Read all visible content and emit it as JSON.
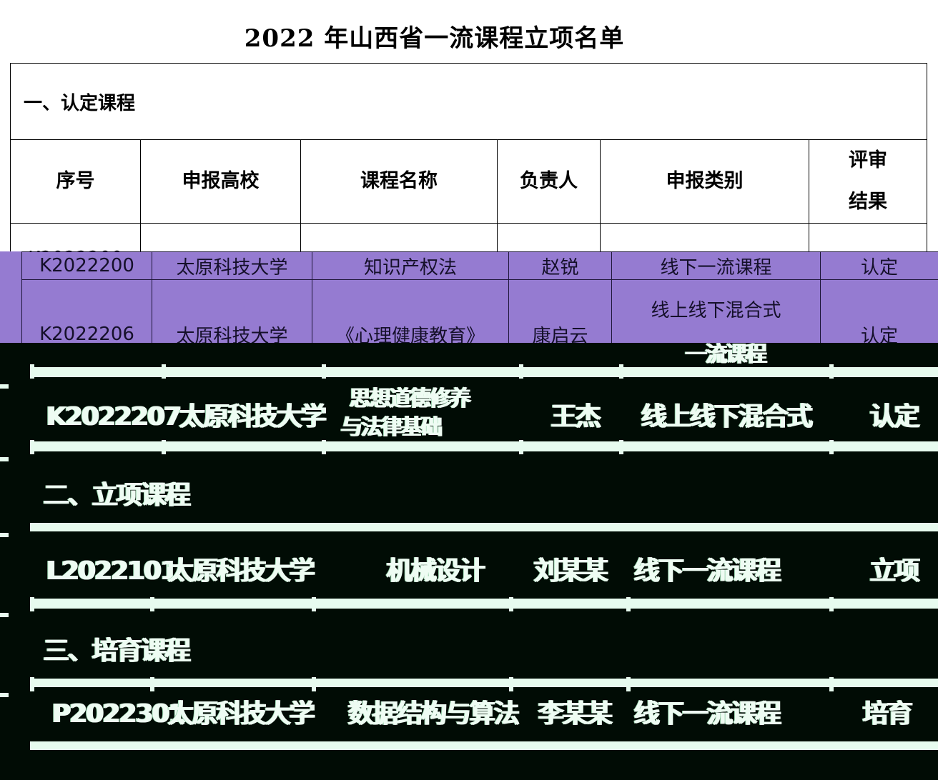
{
  "doc": {
    "title_year": "2022",
    "title_text": " 年山西省一流课程立项名单"
  },
  "section1": {
    "label": "一、认定课程"
  },
  "headers": {
    "index": "序号",
    "school": "申报高校",
    "course": "课程名称",
    "owner": "负责人",
    "category": "申报类别",
    "result_line1": "评审",
    "result_line2": "结果"
  },
  "rows": [
    {
      "index": "K2022200",
      "school": "太原科技大学",
      "course": "知识产权法",
      "owner": "赵锐",
      "category": "线下一流课程",
      "result": "认定"
    },
    {
      "index": "K2022206",
      "school": "太原科技大学",
      "course": "《心理健康教育》",
      "owner": "康启云",
      "category_line1": "线上线下混合式",
      "category_line2": "一流课程",
      "result": "认定"
    }
  ],
  "garbled": {
    "r3_cat": "一流课程",
    "r4_index": "K2022207",
    "r4_school": "太原科技大学",
    "r4_course_line1": "思想道德修养",
    "r4_course_line2": "与法律基础",
    "r4_owner": "王杰",
    "r4_category": "线上线下混合式",
    "r4_result": "认定",
    "section2": "二、立项课程",
    "r5_index": "L2022101",
    "r5_school": "太原科技大学",
    "r5_course": "机械设计",
    "r5_owner": "刘某某",
    "r5_category": "线下一流课程",
    "r5_result": "立项",
    "section3": "三、培育课程",
    "r6_index": "P2022301",
    "r6_school": "太原科技大学",
    "r6_course": "数据结构与算法",
    "r6_owner": "李某某",
    "r6_category": "线下一流课程",
    "r6_result": "培育"
  },
  "colors": {
    "purple_band": "#957bd1",
    "dark_band": "#010c05",
    "glitch_line": "#e7fbef"
  }
}
